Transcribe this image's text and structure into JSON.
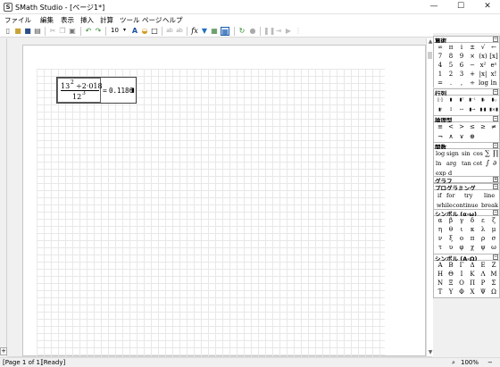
{
  "window": {
    "title": "SMath Studio - [ページ1*]",
    "app_icon": "S"
  },
  "window_controls": [
    "—",
    "☐",
    "✕"
  ],
  "menu": [
    "ファイル",
    "編集",
    "表示",
    "挿入",
    "計算",
    "ツール",
    "ページ",
    "ヘルプ"
  ],
  "toolbar": {
    "font_size": "10",
    "icons": [
      "new-page-icon",
      "open-folder-icon",
      "save-icon",
      "print-icon",
      "cut-icon",
      "copy-icon",
      "paste-icon",
      "undo-icon",
      "redo-icon",
      "font-size-select",
      "text-color-icon",
      "fill-color-icon",
      "border-icon",
      "text-insert-icon",
      "filter-icon",
      "image-icon",
      "grid-toggle-icon",
      "function-icon",
      "insert-filter-icon",
      "matrix-icon",
      "page-icon",
      "calculate-icon",
      "stop-icon",
      "pause-icon",
      "play-icon",
      "step-icon",
      "debug-icon"
    ]
  },
  "formula": {
    "num_base": "13",
    "num_exp": "2",
    "num_rest": "÷2·018",
    "den_base": "12",
    "den_exp": "3",
    "equals": "=",
    "result": "0.1186"
  },
  "panel": {
    "arithmetic": {
      "title": "算術",
      "rows": [
        [
          "∞",
          "π",
          "i",
          "±",
          "√",
          "←"
        ],
        [
          "7",
          "8",
          "9",
          "×",
          "(x)",
          "[x]"
        ],
        [
          "4",
          "5",
          "6",
          "−",
          "x²",
          "eˣ"
        ],
        [
          "1",
          "2",
          "3",
          "+",
          "|x|",
          "x!"
        ],
        [
          "=",
          ".",
          ",",
          "÷",
          "log",
          "ln"
        ]
      ]
    },
    "matrix": {
      "title": "行列",
      "rows": [
        [
          "[·]",
          "▮",
          "▮ᵀ",
          "▮⁻¹",
          "▮ᵢ",
          "▮ᵢⱼ"
        ],
        [
          "▮ⁱ",
          "↕",
          "↔",
          "▮→",
          "▮·▮",
          "▮×▮"
        ]
      ]
    },
    "boolean": {
      "title": "論理型",
      "rows": [
        [
          "≡",
          "<",
          ">",
          "≤",
          "≥",
          "≠"
        ],
        [
          "¬",
          "∧",
          "∨",
          "⊕"
        ]
      ]
    },
    "functions": {
      "title": "関数",
      "rows": [
        [
          "log",
          "sign",
          "sin",
          "cos",
          "∑",
          "∏"
        ],
        [
          "ln",
          "arg",
          "tan",
          "cot",
          "∫",
          "∂"
        ],
        [
          "exp",
          "d"
        ]
      ]
    },
    "graph": {
      "title": "グラフ"
    },
    "programming": {
      "title": "プログラミング",
      "rows": [
        [
          "if",
          "for",
          "try",
          "line"
        ],
        [
          "while",
          "continue",
          "break"
        ]
      ]
    },
    "greek_lower": {
      "title": "シンボル (α-ω)",
      "rows": [
        [
          "α",
          "β",
          "γ",
          "δ",
          "ε",
          "ζ"
        ],
        [
          "η",
          "θ",
          "ι",
          "κ",
          "λ",
          "μ"
        ],
        [
          "ν",
          "ξ",
          "ο",
          "π",
          "ρ",
          "σ"
        ],
        [
          "τ",
          "υ",
          "φ",
          "χ",
          "ψ",
          "ω"
        ]
      ]
    },
    "greek_upper": {
      "title": "シンボル (Α-Ω)",
      "rows": [
        [
          "Α",
          "Β",
          "Γ",
          "Δ",
          "Ε",
          "Ζ"
        ],
        [
          "Η",
          "Θ",
          "Ι",
          "Κ",
          "Λ",
          "Μ"
        ],
        [
          "Ν",
          "Ξ",
          "Ο",
          "Π",
          "Ρ",
          "Σ"
        ],
        [
          "Τ",
          "Υ",
          "Φ",
          "Χ",
          "Ψ",
          "Ω"
        ]
      ]
    }
  },
  "status": {
    "page": "[Page 1 of 1]",
    "state": "[Ready]",
    "zoom": "100%"
  }
}
